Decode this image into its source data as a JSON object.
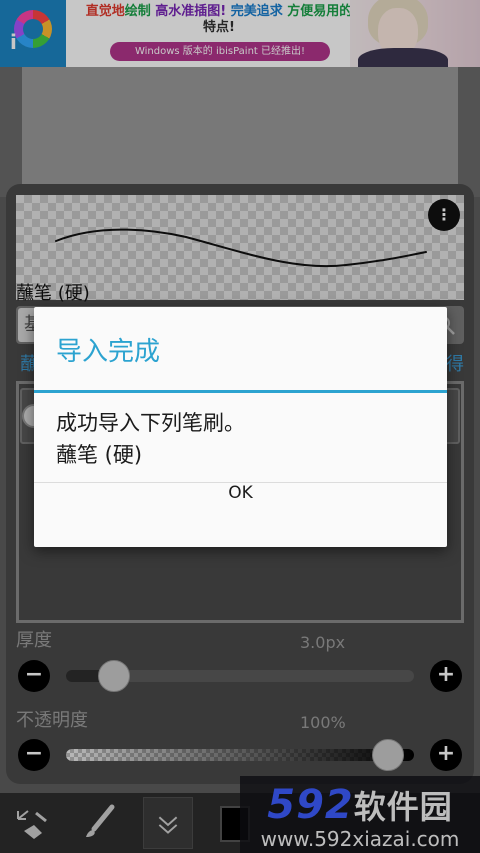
{
  "ad": {
    "headline_parts": [
      "直觉地",
      "绘制",
      "高水准插图!",
      "完美追求",
      "方便易用的"
    ],
    "headline_line2": "特点!",
    "pill": "Windows 版本的 ibisPaint 已经推出!"
  },
  "brush": {
    "name": "蘸笔 (硬)",
    "search_tab": "基",
    "category_left": "蘸",
    "category_right": "得"
  },
  "thickness": {
    "label": "厚度",
    "value": "3.0px",
    "level": 0.1
  },
  "opacity": {
    "label": "不透明度",
    "value": "100%",
    "level": 1.0
  },
  "dialog": {
    "title": "导入完成",
    "message_line1": "成功导入下列笔刷。",
    "message_line2": "蘸笔 (硬)",
    "ok": "OK"
  },
  "watermark": {
    "number": "592",
    "name": "软件园",
    "url": "www.592xiazai.com"
  },
  "colors": {
    "accent": "#2ca3d0",
    "panel": "#4a4a4a",
    "category": "#3d9dd6"
  }
}
